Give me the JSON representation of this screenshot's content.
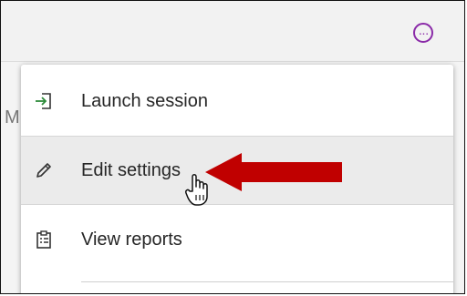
{
  "toolbar": {
    "more_icon": "more-horizontal-icon",
    "more_glyph": "···",
    "accent": "#8a2aa8"
  },
  "background": {
    "partial_text": "M"
  },
  "menu": {
    "items": [
      {
        "label": "Launch session",
        "icon": "enter-session-icon",
        "icon_color": "#2e8b3a"
      },
      {
        "label": "Edit settings",
        "icon": "pencil-icon",
        "state": "hovered"
      },
      {
        "label": "View reports",
        "icon": "clipboard-report-icon"
      }
    ]
  },
  "annotation": {
    "arrow_color": "#c00000",
    "cursor": "hand-pointer-icon"
  }
}
